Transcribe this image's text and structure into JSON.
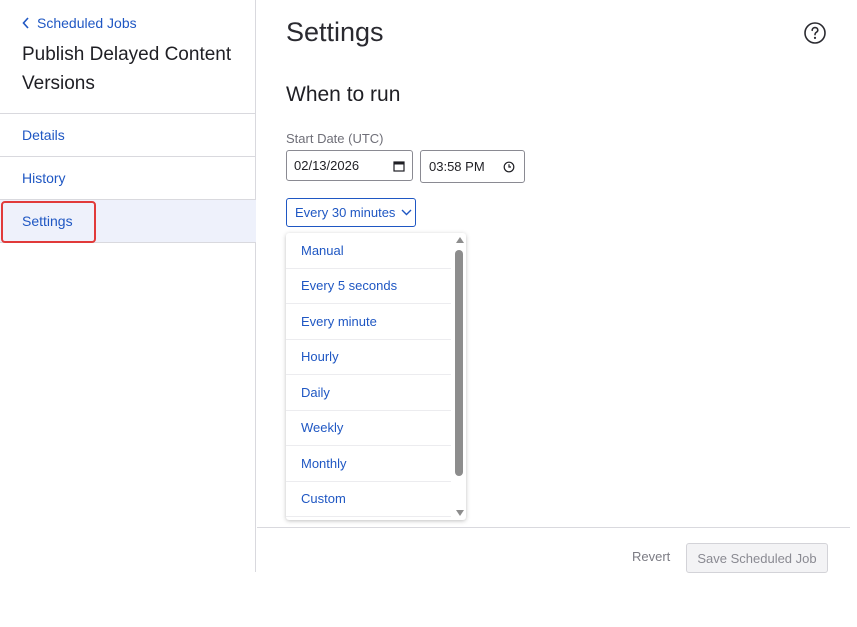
{
  "sidebar": {
    "back_label": "Scheduled Jobs",
    "job_title": "Publish Delayed Content Versions",
    "nav": [
      {
        "label": "Details"
      },
      {
        "label": "History"
      },
      {
        "label": "Settings"
      }
    ]
  },
  "main": {
    "title": "Settings",
    "section_title": "When to run",
    "start_date_label": "Start Date (UTC)",
    "start_date_value": "02/13/2026",
    "start_time_value": "03:58 PM",
    "frequency_selected": "Every 30 minutes",
    "frequency_options": [
      "Manual",
      "Every 5 seconds",
      "Every minute",
      "Hourly",
      "Daily",
      "Weekly",
      "Monthly",
      "Custom"
    ]
  },
  "footer": {
    "revert_label": "Revert",
    "save_label": "Save Scheduled Job"
  },
  "colors": {
    "link": "#1f57c3",
    "active_nav_bg": "#eef1fb",
    "highlight_outline": "#e13a3a"
  },
  "icons": {
    "back": "chevron-left-icon",
    "help": "question-circle-icon",
    "calendar": "calendar-icon",
    "clock": "clock-icon",
    "dropdown": "chevron-down-icon"
  }
}
